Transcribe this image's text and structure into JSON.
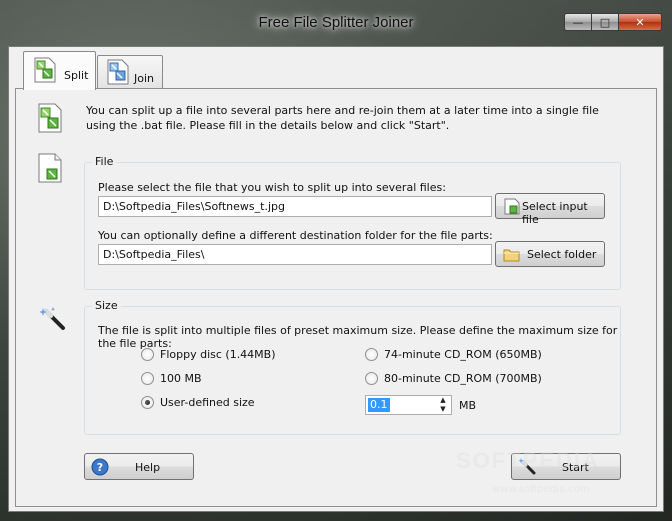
{
  "window": {
    "title": "Free File Splitter Joiner"
  },
  "caption": {
    "minimize": "—",
    "maximize": "□",
    "close": "✕"
  },
  "tabs": [
    {
      "label": "Split",
      "icon": "split-icon",
      "active": true
    },
    {
      "label": "Join",
      "icon": "join-icon",
      "active": false
    }
  ],
  "intro": "You can split up a file into several parts here and re-join them at a later time into a single file using the .bat file. Please fill in the details below and click \"Start\".",
  "file_group": {
    "legend": "File",
    "input_prompt": "Please select the file that you wish to split up into several files:",
    "input_value": "D:\\Softpedia_Files\\Softnews_t.jpg",
    "select_input_label": "Select input file",
    "dest_prompt": "You can optionally define a different destination folder for the file parts:",
    "dest_value": "D:\\Softpedia_Files\\",
    "select_folder_label": "Select folder"
  },
  "size_group": {
    "legend": "Size",
    "description": "The file is split into multiple files of preset maximum size. Please define the maximum size for the file parts:",
    "options": [
      {
        "label": "Floppy disc (1.44MB)",
        "checked": false
      },
      {
        "label": "74-minute CD_ROM (650MB)",
        "checked": false
      },
      {
        "label": "100 MB",
        "checked": false
      },
      {
        "label": "80-minute CD_ROM (700MB)",
        "checked": false
      },
      {
        "label": "User-defined size",
        "checked": true
      }
    ],
    "user_value": "0.1",
    "unit": "MB"
  },
  "buttons": {
    "help": "Help",
    "start": "Start"
  },
  "watermark": {
    "text": "SOFTPEDIA",
    "url": "www.softpedia.com"
  }
}
